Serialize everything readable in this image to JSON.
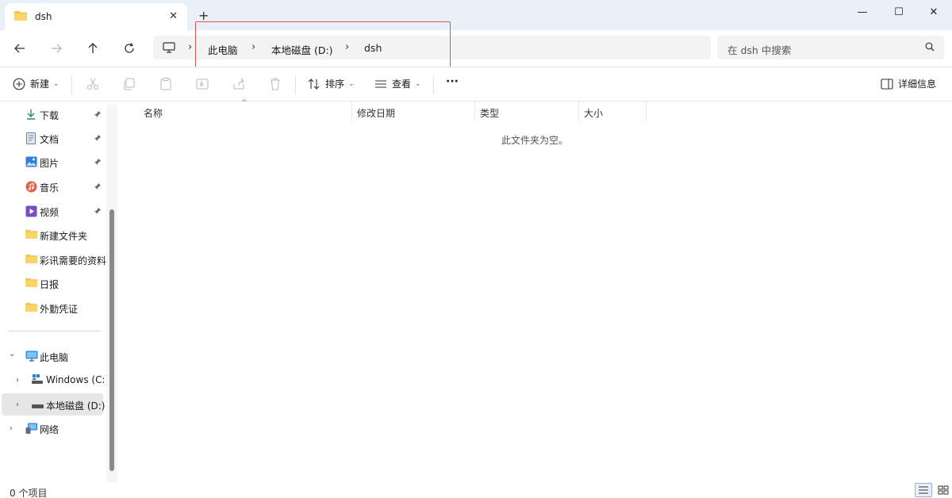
{
  "window": {
    "tab_title": "dsh",
    "tab_close": "✕",
    "new_tab": "+",
    "minimize": "—",
    "maximize": "☐",
    "close": "✕"
  },
  "address": {
    "breadcrumbs": [
      "此电脑",
      "本地磁盘 (D:)",
      "dsh"
    ],
    "separator": "›"
  },
  "search": {
    "placeholder": "在 dsh 中搜索"
  },
  "commandbar": {
    "new_label": "新建",
    "sort_label": "排序",
    "view_label": "查看",
    "more_label": "···",
    "details_label": "详细信息",
    "caret": "⌄"
  },
  "sidebar": {
    "quick_access": [
      {
        "label": "下载",
        "icon": "download-icon",
        "pinned": true
      },
      {
        "label": "文档",
        "icon": "document-icon",
        "pinned": true
      },
      {
        "label": "图片",
        "icon": "pictures-icon",
        "pinned": true
      },
      {
        "label": "音乐",
        "icon": "music-icon",
        "pinned": true
      },
      {
        "label": "视频",
        "icon": "video-icon",
        "pinned": true
      },
      {
        "label": "新建文件夹",
        "icon": "folder-icon",
        "pinned": false
      },
      {
        "label": "彩讯需要的资料",
        "icon": "folder-icon",
        "pinned": false
      },
      {
        "label": "日报",
        "icon": "folder-icon",
        "pinned": false
      },
      {
        "label": "外勤凭证",
        "icon": "folder-icon",
        "pinned": false
      }
    ],
    "this_pc": "此电脑",
    "drive_c": "Windows (C:)",
    "drive_d": "本地磁盘 (D:)",
    "network": "网络",
    "chev_down": "⌄",
    "chev_right": "›"
  },
  "columns": [
    "名称",
    "修改日期",
    "类型",
    "大小"
  ],
  "sort_indicator": "^",
  "empty_message": "此文件夹为空。",
  "status": {
    "item_count": "0 个项目"
  },
  "colors": {
    "folder": "#f4c553",
    "accent": "#0067c0",
    "highlight": "#e05353",
    "titlebar": "#eaf0f8"
  }
}
